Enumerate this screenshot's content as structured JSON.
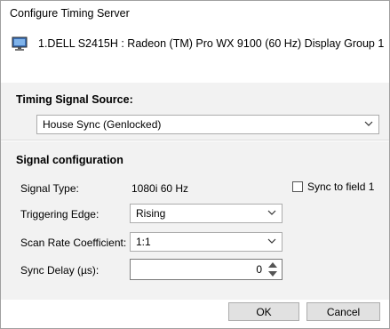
{
  "window": {
    "title": "Configure Timing Server"
  },
  "display": {
    "label": "1.DELL S2415H : Radeon (TM) Pro WX 9100 (60 Hz) Display Group 1",
    "icon": "monitor-icon"
  },
  "timing_source": {
    "header": "Timing Signal Source:",
    "selected": "House Sync (Genlocked)"
  },
  "signal_config": {
    "header": "Signal configuration",
    "signal_type_label": "Signal Type:",
    "signal_type_value": "1080i 60 Hz",
    "sync_field_label": "Sync to field 1",
    "sync_field_checked": false,
    "triggering_edge_label": "Triggering Edge:",
    "triggering_edge_value": "Rising",
    "scan_rate_label": "Scan Rate Coefficient:",
    "scan_rate_value": "1:1",
    "sync_delay_label": "Sync Delay (µs):",
    "sync_delay_value": "0"
  },
  "buttons": {
    "ok": "OK",
    "cancel": "Cancel"
  }
}
